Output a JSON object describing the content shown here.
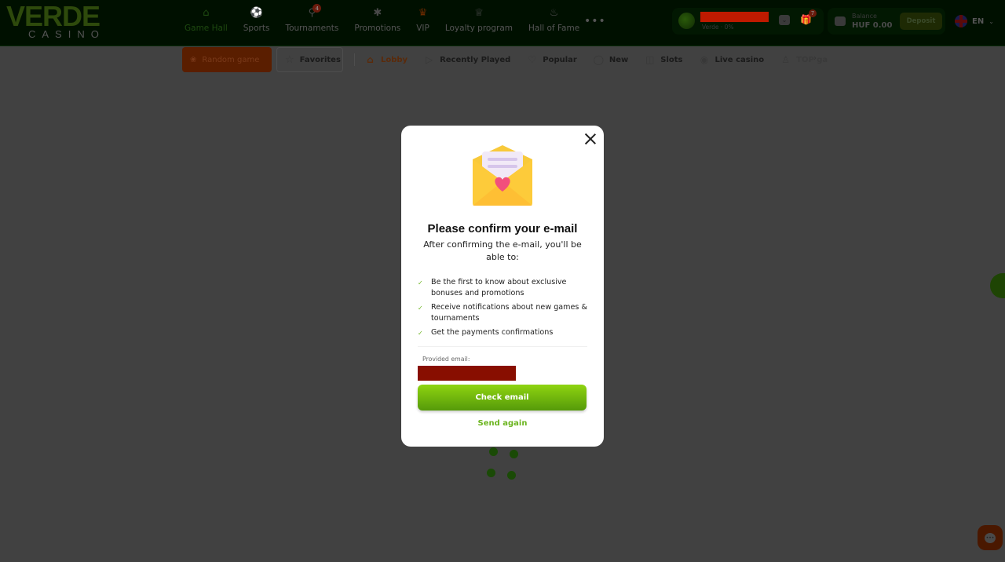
{
  "header": {
    "logo": {
      "title": "VERDE",
      "subtitle": "CASINO"
    },
    "nav": [
      {
        "label": "Game Hall",
        "icon": "home-icon",
        "active": true
      },
      {
        "label": "Sports",
        "icon": "soccer-ball-icon"
      },
      {
        "label": "Tournaments",
        "icon": "trophy-icon",
        "badge": "4"
      },
      {
        "label": "Promotions",
        "icon": "percent-badge-icon"
      },
      {
        "label": "VIP",
        "icon": "vip-crown-icon"
      },
      {
        "label": "Loyalty program",
        "icon": "crown-icon"
      },
      {
        "label": "Hall of Fame",
        "icon": "flame-icon"
      }
    ],
    "more_label": "•••",
    "user": {
      "level_text": "Verde · 0%",
      "gift_badge": "7"
    },
    "balance": {
      "label": "Balance",
      "value": "HUF 0.00"
    },
    "deposit_label": "Deposit",
    "language": "EN"
  },
  "categories": {
    "random_label": "Random game",
    "favorites_label": "Favorites",
    "items": [
      {
        "label": "Lobby",
        "icon": "house-icon",
        "active": true
      },
      {
        "label": "Recently Played",
        "icon": "play-icon"
      },
      {
        "label": "Popular",
        "icon": "heart-icon"
      },
      {
        "label": "New",
        "icon": "new-icon"
      },
      {
        "label": "Slots",
        "icon": "slot-machine-icon"
      },
      {
        "label": "Live casino",
        "icon": "live-icon"
      },
      {
        "label": "TOP ga",
        "icon": "podium-icon"
      }
    ]
  },
  "modal": {
    "title": "Please confirm your e-mail",
    "subtitle": "After confirming the e-mail, you'll be able to:",
    "benefits": [
      "Be the first to know about exclusive bonuses and promotions",
      "Receive notifications about new games & tournaments",
      "Get the payments confirmations"
    ],
    "email_label": "Provided email:",
    "check_button": "Check email",
    "send_again": "Send again"
  },
  "colors": {
    "accent_green": "#6cb520",
    "overlay_bg": "#414141",
    "redaction": "#c01a00"
  }
}
